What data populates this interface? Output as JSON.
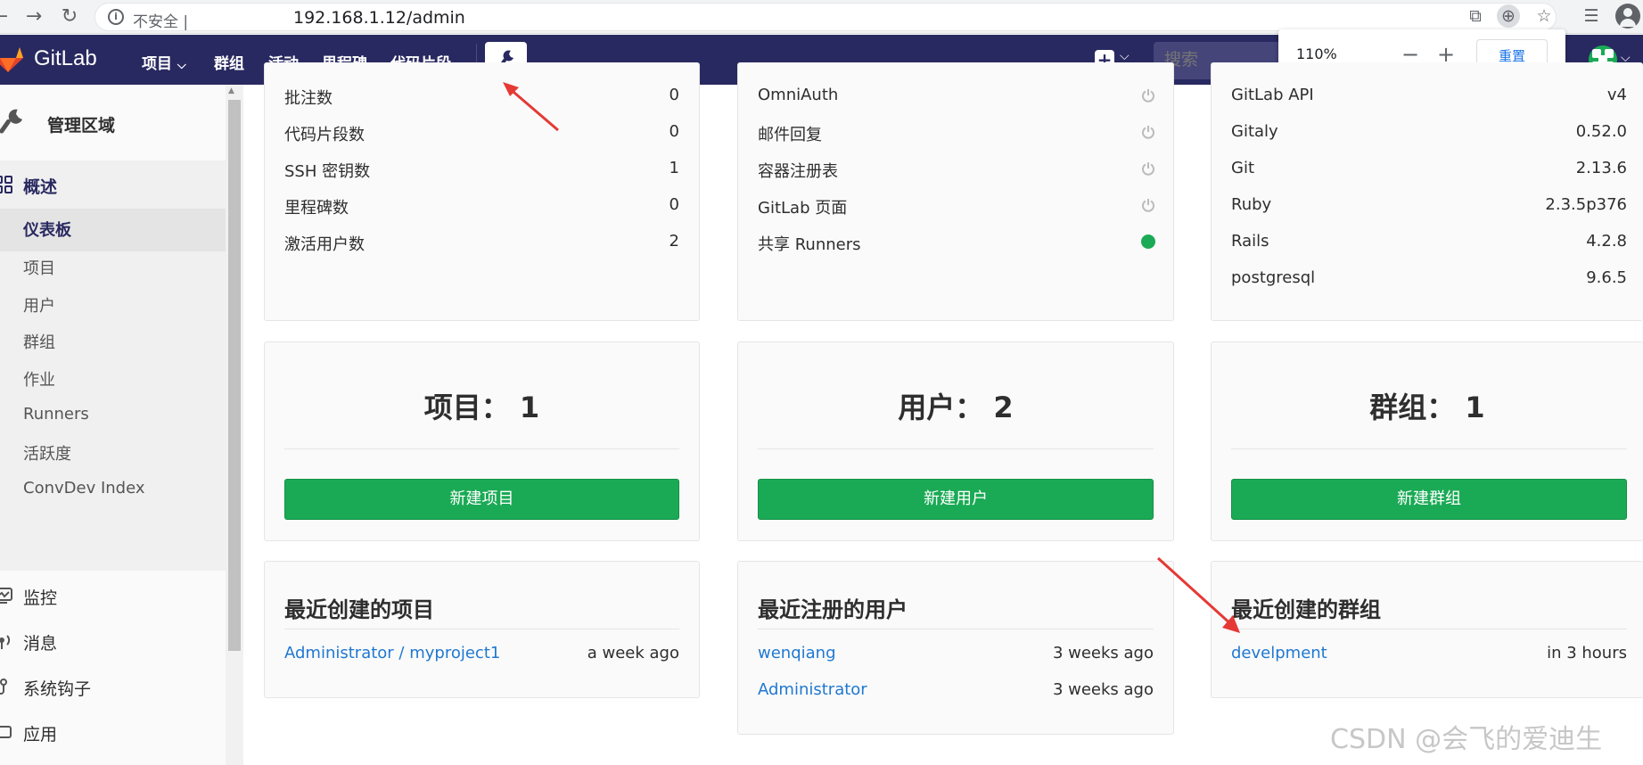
{
  "browser": {
    "insecure_label": "不安全 |",
    "url": "192.168.1.12/admin",
    "zoom_popup": {
      "percent": "110%",
      "minus": "−",
      "plus": "+",
      "reset": "重置"
    }
  },
  "header": {
    "brand": "GitLab",
    "nav": [
      "项目",
      "群组",
      "活动",
      "里程碑",
      "代码片段"
    ],
    "nav_first_caret": "⌵",
    "search_placeholder": "搜索",
    "plus": "+",
    "caret": "⌵"
  },
  "sidebar": {
    "context_title": "管理区域",
    "overview": "概述",
    "items": [
      "仪表板",
      "项目",
      "用户",
      "群组",
      "作业",
      "Runners",
      "活跃度",
      "ConvDev Index"
    ],
    "active_item": "仪表板",
    "sections": [
      "监控",
      "消息",
      "系统钩子",
      "应用"
    ]
  },
  "stats_panel": {
    "rows": [
      {
        "label": "批注数",
        "value": "0"
      },
      {
        "label": "代码片段数",
        "value": "0"
      },
      {
        "label": "SSH 密钥数",
        "value": "1"
      },
      {
        "label": "里程碑数",
        "value": "0"
      },
      {
        "label": "激活用户数",
        "value": "2"
      }
    ]
  },
  "features_panel": {
    "rows": [
      {
        "label": "OmniAuth",
        "status": "off"
      },
      {
        "label": "邮件回复",
        "status": "off"
      },
      {
        "label": "容器注册表",
        "status": "off"
      },
      {
        "label": "GitLab 页面",
        "status": "off"
      },
      {
        "label": "共享 Runners",
        "status": "on"
      }
    ]
  },
  "components_panel": {
    "rows": [
      {
        "label": "GitLab API",
        "value": "v4"
      },
      {
        "label": "Gitaly",
        "value": "0.52.0"
      },
      {
        "label": "Git",
        "value": "2.13.6"
      },
      {
        "label": "Ruby",
        "value": "2.3.5p376"
      },
      {
        "label": "Rails",
        "value": "4.2.8"
      },
      {
        "label": "postgresql",
        "value": "9.6.5"
      }
    ]
  },
  "counters": [
    {
      "title": "项目： 1",
      "button": "新建项目"
    },
    {
      "title": "用户： 2",
      "button": "新建用户"
    },
    {
      "title": "群组： 1",
      "button": "新建群组"
    }
  ],
  "recent": [
    {
      "title": "最近创建的项目",
      "items": [
        {
          "name": "Administrator / myproject1",
          "time": "a week ago"
        }
      ]
    },
    {
      "title": "最近注册的用户",
      "items": [
        {
          "name": "wenqiang",
          "time": "3 weeks ago"
        },
        {
          "name": "Administrator",
          "time": "3 weeks ago"
        }
      ]
    },
    {
      "title": "最近创建的群组",
      "items": [
        {
          "name": "develpment",
          "time": "in 3 hours"
        }
      ]
    }
  ],
  "watermark": "CSDN @会飞的爱迪生",
  "colors": {
    "header": "#292961",
    "green": "#1aaa55",
    "link": "#1f78d1",
    "annotation_arrow": "#e53935"
  }
}
